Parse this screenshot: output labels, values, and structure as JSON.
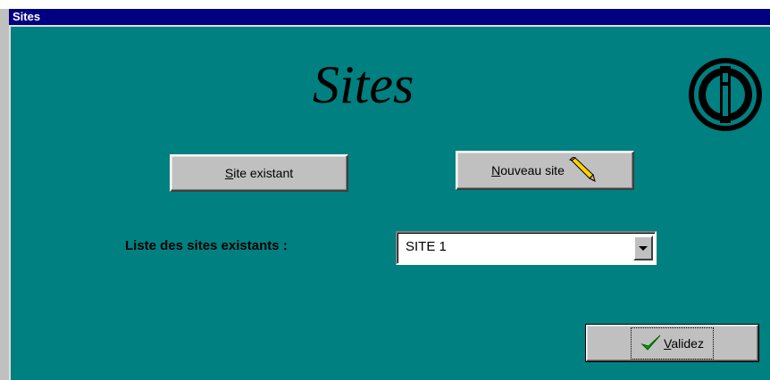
{
  "window": {
    "title": "Sites"
  },
  "header": {
    "big_title": "Sites",
    "logo_icon": "circled-i-logo-icon"
  },
  "buttons": {
    "existing_site": {
      "prefix": "",
      "mnemonic": "S",
      "rest": "ite existant"
    },
    "new_site": {
      "prefix": "",
      "mnemonic": "N",
      "rest": "ouveau site",
      "icon": "pencil-icon"
    },
    "validate": {
      "prefix": "",
      "mnemonic": "V",
      "rest": "alidez",
      "icon": "checkmark-icon"
    }
  },
  "site_list": {
    "label": "Liste des sites existants :",
    "selected": "SITE 1",
    "arrow_icon": "chevron-down-icon"
  },
  "colors": {
    "client_background": "#008080",
    "titlebar": "#000080",
    "button_face": "#c0c0c0",
    "checkmark": "#00a000"
  }
}
